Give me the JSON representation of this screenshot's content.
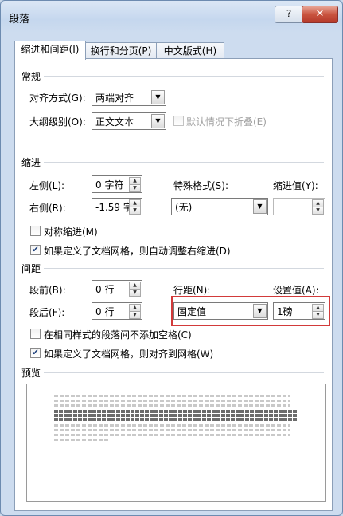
{
  "window": {
    "title": "段落",
    "help_label": "?",
    "close_label": "✕"
  },
  "tabs": [
    {
      "label": "缩进和间距(I)",
      "active": true
    },
    {
      "label": "换行和分页(P)",
      "active": false
    },
    {
      "label": "中文版式(H)",
      "active": false
    }
  ],
  "general": {
    "section_label": "常规",
    "alignment_label": "对齐方式(G):",
    "alignment_value": "两端对齐",
    "outline_label": "大纲级别(O):",
    "outline_value": "正文文本",
    "collapse_label": "默认情况下折叠(E)"
  },
  "indent": {
    "section_label": "缩进",
    "left_label": "左侧(L):",
    "left_value": "0 字符",
    "right_label": "右侧(R):",
    "right_value": "-1.59 字",
    "special_label": "特殊格式(S):",
    "special_value": "(无)",
    "indent_by_label": "缩进值(Y):",
    "indent_by_value": "",
    "mirror_label": "对称缩进(M)",
    "auto_adjust_label": "如果定义了文档网格，则自动调整右缩进(D)"
  },
  "spacing": {
    "section_label": "间距",
    "before_label": "段前(B):",
    "before_value": "0 行",
    "after_label": "段后(F):",
    "after_value": "0 行",
    "line_spacing_label": "行距(N):",
    "line_spacing_value": "固定值",
    "at_label": "设置值(A):",
    "at_value": "1磅",
    "no_space_label": "在相同样式的段落间不添加空格(C)",
    "snap_grid_label": "如果定义了文档网格，则对齐到网格(W)"
  },
  "preview": {
    "section_label": "预览"
  },
  "icons": {
    "dropdown": "▼",
    "spin_up": "▲",
    "spin_down": "▼",
    "check": "✔"
  }
}
